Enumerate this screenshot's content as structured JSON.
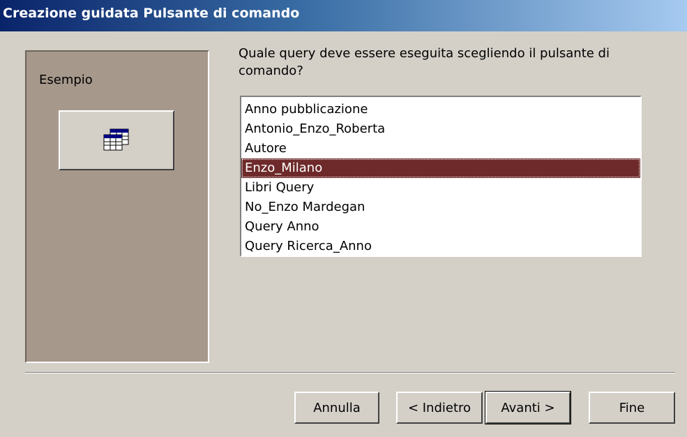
{
  "window": {
    "title": "Creazione guidata Pulsante di comando"
  },
  "sample": {
    "label": "Esempio",
    "button_icon": "datasheet-query-icon"
  },
  "question": "Quale query deve essere eseguita scegliendo il pulsante di comando?",
  "query_list": {
    "items": [
      "Anno pubblicazione",
      "Antonio_Enzo_Roberta",
      "Autore",
      "Enzo_Milano",
      "Libri Query",
      "No_Enzo Mardegan",
      "Query Anno",
      "Query Ricerca_Anno"
    ],
    "selected": "Enzo_Milano"
  },
  "buttons": {
    "cancel": "Annulla",
    "back": "< Indietro",
    "next": "Avanti >",
    "finish": "Fine"
  },
  "colors": {
    "selection": "#6e2a2a",
    "sample_panel": "#a6998c",
    "title_start": "#0a246a",
    "title_end": "#a6caf0"
  }
}
